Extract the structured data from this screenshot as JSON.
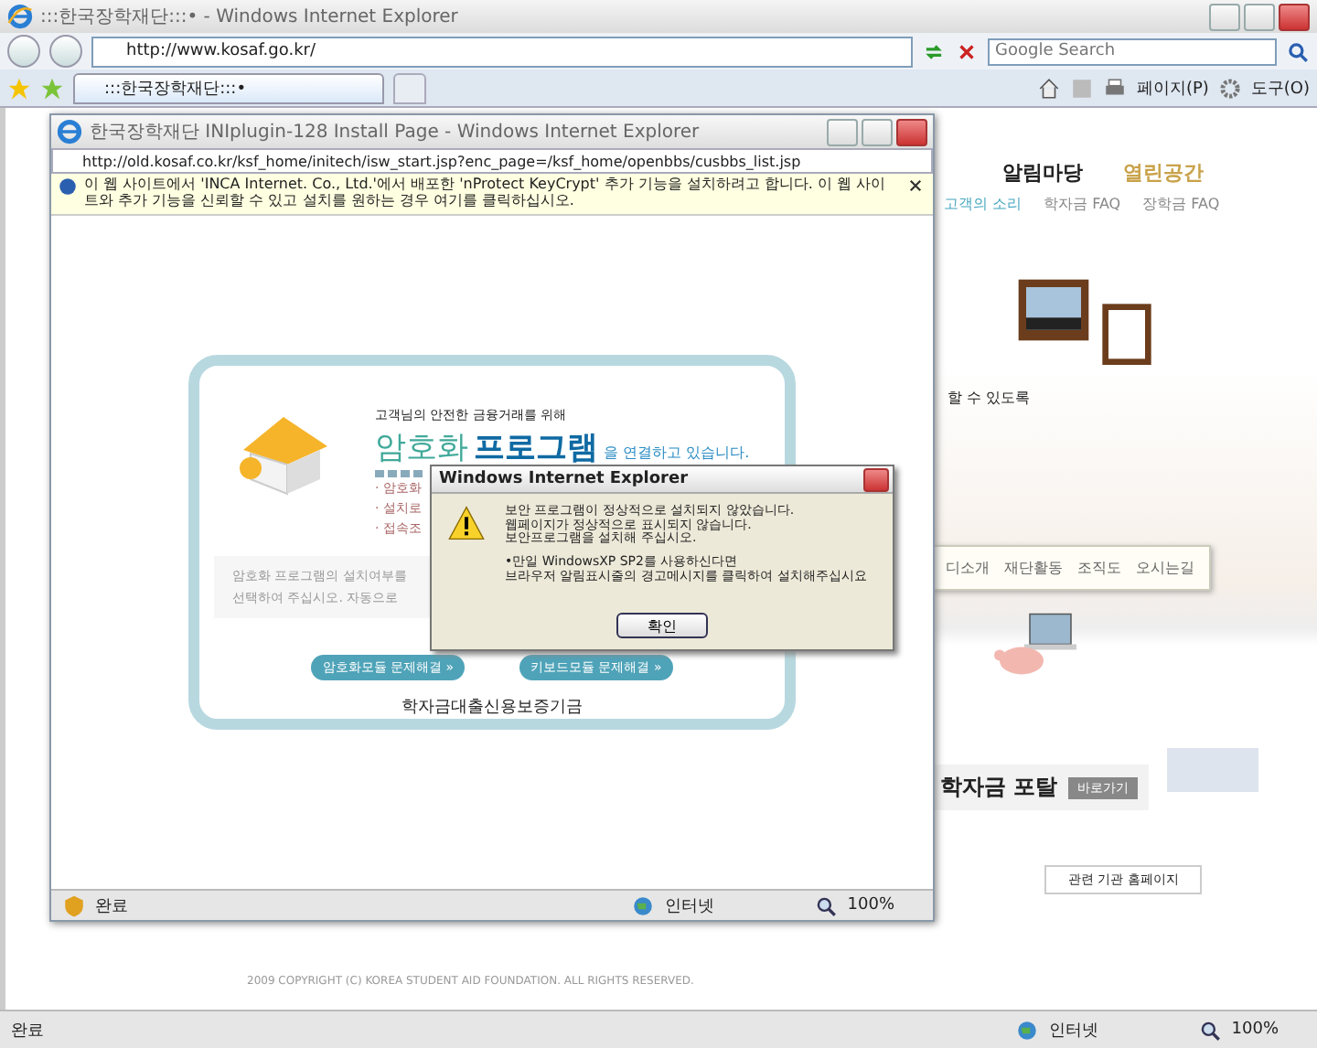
{
  "browser": {
    "title": ":::한국장학재단:::• - Windows Internet Explorer",
    "address": "http://www.kosaf.go.kr/",
    "search": {
      "placeholder": "Google Search"
    },
    "tabs": [
      {
        "label": ":::한국장학재단:::•",
        "selected": true
      }
    ],
    "toolbar": {
      "page": "페이지(P)",
      "tools": "도구(O)"
    },
    "status": {
      "text": "완료",
      "zone": "인터넷",
      "zoom": "100%"
    }
  },
  "background_page": {
    "nav": [
      {
        "label": "알림마당",
        "color": "#222222"
      },
      {
        "label": "열린공간",
        "color": "#c9a24a"
      }
    ],
    "subnav": [
      {
        "label": "고객의 소리",
        "selected": true
      },
      {
        "label": "학자금 FAQ",
        "selected": false
      },
      {
        "label": "장학금 FAQ",
        "selected": false
      }
    ],
    "caption": "할 수 있도록",
    "menu": [
      "디소개",
      "재단활동",
      "조직도",
      "오시는길"
    ],
    "banner": {
      "title": "학자금 포탈",
      "button": "바로가기"
    },
    "related_select": "관련 기관 홈페이지",
    "copyright": "2009 COPYRIGHT (C) KOREA STUDENT AID FOUNDATION. ALL RIGHTS RESERVED."
  },
  "popup": {
    "title": "한국장학재단 INIplugin-128 Install Page - Windows Internet Explorer",
    "url": "http://old.kosaf.co.kr/ksf_home/initech/isw_start.jsp?enc_page=/ksf_home/openbbs/cusbbs_list.jsp",
    "infobar": "이 웹 사이트에서 'INCA Internet. Co., Ltd.'에서 배포한 'nProtect KeyCrypt' 추가 기능을 설치하려고 합니다. 이 웹 사이트와 추가 기능을 신뢰할 수 있고 설치를 원하는 경우 여기를 클릭하십시오.",
    "subtitle": "고객님의 안전한 금융거래를 위해",
    "headline": [
      "암호화",
      "프로그램",
      "을 연결하고 있습니다."
    ],
    "bullets": [
      "· 암호화",
      "· 설치로",
      "· 접속조"
    ],
    "notice": [
      "암호화 프로그램의 설치여부를",
      "선택하여 주십시오. 자동으로"
    ],
    "buttons": [
      "암호화모듈 문제해결 »",
      "키보드모듈 문제해결 »"
    ],
    "footer": "학자금대출신용보증기금",
    "status": {
      "text": "완료",
      "zone": "인터넷",
      "zoom": "100%"
    }
  },
  "dialog": {
    "title": "Windows Internet Explorer",
    "lines": [
      "보안 프로그램이 정상적으로 설치되지 않았습니다.",
      "웹페이지가 정상적으로 표시되지 않습니다.",
      "보안프로그램을 설치해 주십시오."
    ],
    "note": [
      "•만일 WindowsXP SP2를 사용하신다면",
      "브라우저 알림표시줄의 경고메시지를 클릭하여 설치해주십시요"
    ],
    "button": "확인"
  }
}
